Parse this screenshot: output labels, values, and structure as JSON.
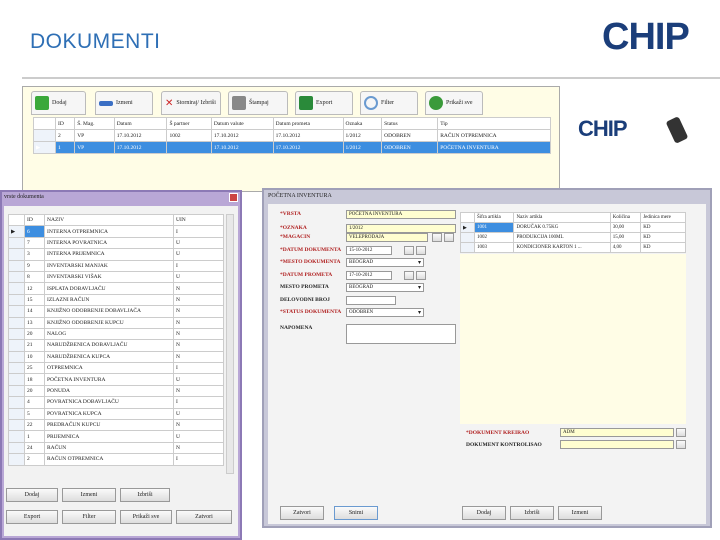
{
  "slide_title": "DOKUMENTI",
  "logo_text": "CHIP",
  "main_window": {
    "toolbar": [
      "Dodaj",
      "Izmeni",
      "Storniraj/ Izbriši",
      "Štampaj",
      "Export",
      "Filter",
      "Prikaži sve"
    ],
    "columns": [
      "ID",
      "Š. Mag.",
      "Datum",
      "Š partner",
      "Datum valute",
      "Datum prometa",
      "Oznaka",
      "Status",
      "Tip"
    ],
    "rows": [
      [
        "2",
        "VP",
        "17.10.2012",
        "1002",
        "17.10.2012",
        "17.10.2012",
        "1/2012",
        "ODOBREN",
        "RAČUN OTPREMNICA"
      ],
      [
        "1",
        "VP",
        "17.10.2012",
        "",
        "17.10.2012",
        "17.10.2012",
        "1/2012",
        "ODOBREN",
        "POČETNA INVENTURA"
      ]
    ]
  },
  "left_dialog": {
    "title": "vrste dokumenta",
    "columns": [
      "ID",
      "NAZIV",
      "UIN"
    ],
    "rows": [
      [
        "6",
        "INTERNA OTPREMNICA",
        "I"
      ],
      [
        "7",
        "INTERNA POVRATNICA",
        "U"
      ],
      [
        "3",
        "INTERNA PRIJEMNICA",
        "U"
      ],
      [
        "9",
        "INVENTARSKI MANJAK",
        "I"
      ],
      [
        "8",
        "INVENTARSKI VIŠAK",
        "U"
      ],
      [
        "12",
        "ISPLATA DOBAVLJAČU",
        "N"
      ],
      [
        "15",
        "IZLAZNI RAČUN",
        "N"
      ],
      [
        "14",
        "KNJIŽNO ODOBRENJE DOBAVLJAČA",
        "N"
      ],
      [
        "13",
        "KNJIŽNO ODOBRENJE KUPCU",
        "N"
      ],
      [
        "20",
        "NALOG",
        "N"
      ],
      [
        "21",
        "NARUDŽBENICA DOBAVLJAČU",
        "N"
      ],
      [
        "10",
        "NARUDŽBENICA KUPCA",
        "N"
      ],
      [
        "25",
        "OTPREMNICA",
        "I"
      ],
      [
        "18",
        "POČETNA INVENTURA",
        "U"
      ],
      [
        "20",
        "PONUDA",
        "N"
      ],
      [
        "4",
        "POVRATNICA DOBAVLJAČU",
        "I"
      ],
      [
        "5",
        "POVRATNICA KUPCA",
        "U"
      ],
      [
        "22",
        "PREDRAČUN KUPCU",
        "N"
      ],
      [
        "1",
        "PRIJEMNICA",
        "U"
      ],
      [
        "24",
        "RAČUN",
        "N"
      ],
      [
        "2",
        "RAČUN OTPREMNICA",
        "I"
      ]
    ],
    "buttons_row1": [
      "Dodaj",
      "Izmeni",
      "Izbriši"
    ],
    "buttons_row2": [
      "Export",
      "Filter",
      "Prikaži sve",
      "Zatvori"
    ]
  },
  "right_dialog": {
    "title": "POČETNA INVENTURA",
    "fields": [
      {
        "label": "*VRSTA",
        "value": "POČETNA INVENTURA",
        "required": true
      },
      {
        "label": "*OZNAKA",
        "value": "1/2012",
        "required": true
      },
      {
        "label": "*MAGACIN",
        "value": "VELEPRODAJA",
        "required": true
      },
      {
        "label": "*DATUM DOKUMENTA",
        "value": "15-10-2012",
        "required": true
      },
      {
        "label": "*MESTO DOKUMENTA",
        "value": "BEOGRAD",
        "required": true
      },
      {
        "label": "*DATUM PROMETA",
        "value": "17-10-2012",
        "required": true
      },
      {
        "label": "MESTO PROMETA",
        "value": "BEOGRAD",
        "required": false
      },
      {
        "label": "DELOVODNI BROJ",
        "value": "",
        "required": false
      },
      {
        "label": "*STATUS DOKUMENTA",
        "value": "ODOBREN",
        "required": true
      },
      {
        "label": "NAPOMENA",
        "value": "",
        "required": false
      }
    ],
    "item_columns": [
      "Šifra artikla",
      "Naziv artikla",
      "Količina",
      "Jedinica mere"
    ],
    "item_rows": [
      [
        "1001",
        "DORUČAK 0.75KG",
        "30,00",
        "KD"
      ],
      [
        "1002",
        "PRODUKCIJA 100ML",
        "15,00",
        "KD"
      ],
      [
        "1003",
        "KONDICIONER KARTON 1 ...",
        "4,00",
        "KD"
      ]
    ],
    "created_by_label": "*DOKUMENT KREIRAO",
    "created_by": "ADM",
    "controlled_by_label": "DOKUMENT KONTROLISAO",
    "controlled_by": "",
    "buttons_left": [
      "Zatvori",
      "Snimi"
    ],
    "buttons_right": [
      "Dodaj",
      "Izbriši",
      "Izmeni"
    ]
  }
}
